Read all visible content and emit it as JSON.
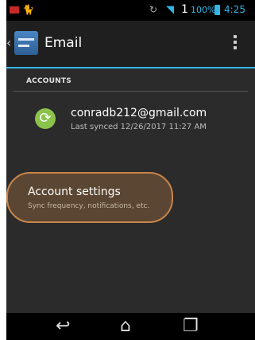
{
  "status_bar": {
    "signal_level": "1",
    "battery": "100%",
    "time": "4:25"
  },
  "action_bar": {
    "title": "Email"
  },
  "accounts_section": {
    "label": "ACCOUNTS",
    "account": {
      "email": "conradb212@gmail.com",
      "sync_status": "Last synced 12/26/2017 11:27 AM"
    }
  },
  "account_settings": {
    "title": "Account settings",
    "subtitle": "Sync frequency, notifications, etc."
  },
  "colors": {
    "accent": "#33b5e5",
    "sync_icon": "#8bc34a",
    "highlight": "#c8854a"
  }
}
